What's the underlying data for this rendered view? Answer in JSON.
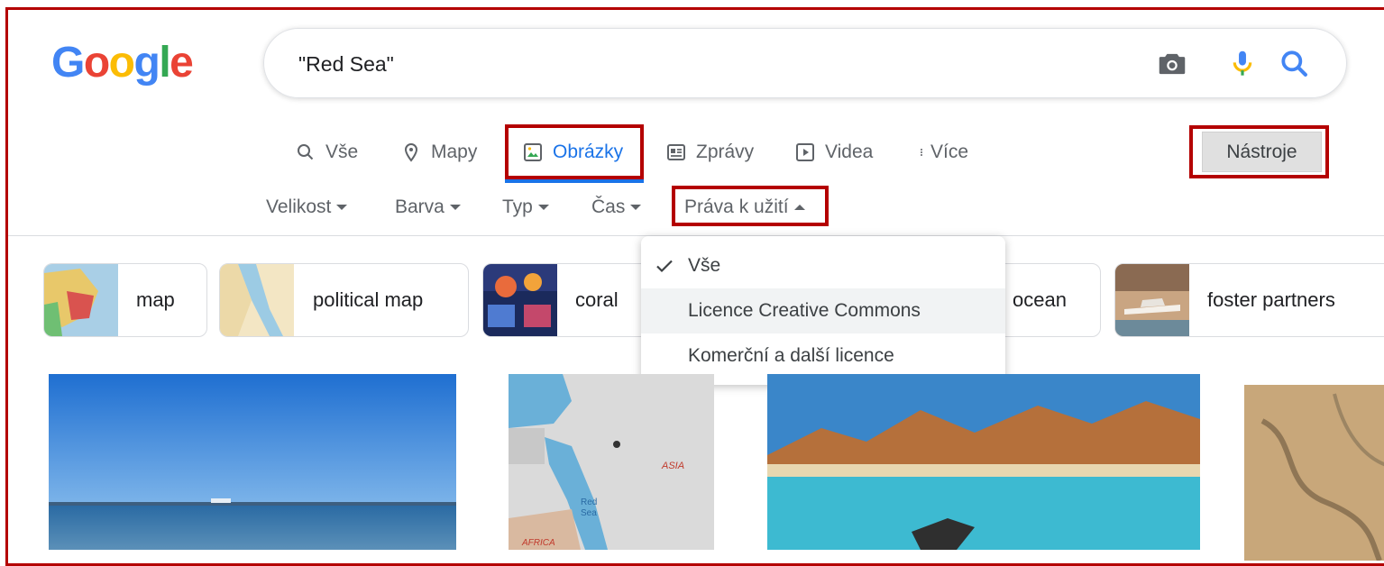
{
  "logo": {
    "letters": [
      "G",
      "o",
      "o",
      "g",
      "l",
      "e"
    ],
    "colors": [
      "#4285F4",
      "#EA4335",
      "#FBBC05",
      "#4285F4",
      "#34A853",
      "#EA4335"
    ]
  },
  "search": {
    "value": "\"Red Sea\""
  },
  "tabs": [
    {
      "label": "Vše",
      "icon": "search-icon"
    },
    {
      "label": "Mapy",
      "icon": "map-pin-icon"
    },
    {
      "label": "Obrázky",
      "icon": "image-icon",
      "active": true
    },
    {
      "label": "Zprávy",
      "icon": "news-icon"
    },
    {
      "label": "Videa",
      "icon": "play-icon"
    },
    {
      "label": "Více",
      "icon": "more-vertical-icon"
    }
  ],
  "tools": {
    "label": "Nástroje"
  },
  "filters": [
    "Velikost",
    "Barva",
    "Typ",
    "Čas",
    "Práva k užití"
  ],
  "chips": [
    "map",
    "political map",
    "coral",
    "ocean",
    "foster partners"
  ],
  "usage_rights_menu": {
    "items": [
      "Vše",
      "Licence Creative Commons",
      "Komerční a další licence"
    ],
    "selected_index": 0,
    "hover_index": 1
  },
  "colors": {
    "accent": "#1a73e8",
    "highlight": "#b40000"
  }
}
